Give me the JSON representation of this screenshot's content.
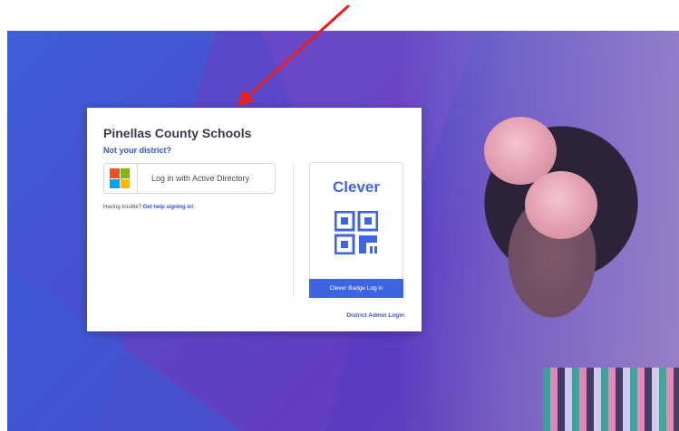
{
  "login_card": {
    "district_name": "Pinellas County Schools",
    "not_your_district": "Not your district?",
    "active_directory_button": "Log in with Active Directory",
    "help_prefix": "Having trouble?",
    "help_link": "Get help signing in!"
  },
  "clever_panel": {
    "logo_text": "Clever",
    "badge_button": "Clever Badge Log in",
    "qr_icon": "qr-code-icon"
  },
  "district_admin_link": "District Admin Login",
  "colors": {
    "clever_blue": "#3e64e0",
    "link_blue": "#3552d8",
    "annotation_red": "#e8201d",
    "microsoft_red": "#f25022",
    "microsoft_green": "#7fba00",
    "microsoft_blue": "#00a4ef",
    "microsoft_yellow": "#ffb900"
  },
  "icons": [
    "microsoft-logo-icon",
    "qr-code-icon",
    "red-arrow-annotation"
  ]
}
